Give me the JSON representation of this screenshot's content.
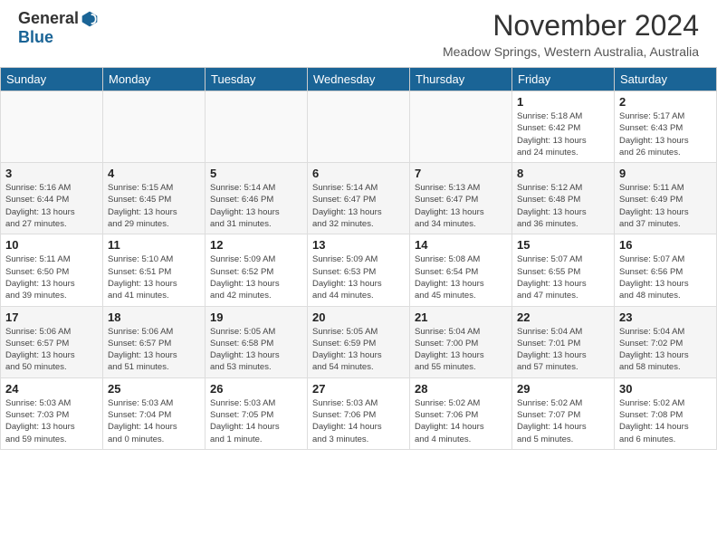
{
  "app": {
    "logo_general": "General",
    "logo_blue": "Blue"
  },
  "header": {
    "title": "November 2024",
    "location": "Meadow Springs, Western Australia, Australia"
  },
  "calendar": {
    "days_of_week": [
      "Sunday",
      "Monday",
      "Tuesday",
      "Wednesday",
      "Thursday",
      "Friday",
      "Saturday"
    ],
    "weeks": [
      {
        "alt": false,
        "days": [
          {
            "num": "",
            "info": "",
            "empty": true
          },
          {
            "num": "",
            "info": "",
            "empty": true
          },
          {
            "num": "",
            "info": "",
            "empty": true
          },
          {
            "num": "",
            "info": "",
            "empty": true
          },
          {
            "num": "",
            "info": "",
            "empty": true
          },
          {
            "num": "1",
            "info": "Sunrise: 5:18 AM\nSunset: 6:42 PM\nDaylight: 13 hours\nand 24 minutes.",
            "empty": false
          },
          {
            "num": "2",
            "info": "Sunrise: 5:17 AM\nSunset: 6:43 PM\nDaylight: 13 hours\nand 26 minutes.",
            "empty": false
          }
        ]
      },
      {
        "alt": true,
        "days": [
          {
            "num": "3",
            "info": "Sunrise: 5:16 AM\nSunset: 6:44 PM\nDaylight: 13 hours\nand 27 minutes.",
            "empty": false
          },
          {
            "num": "4",
            "info": "Sunrise: 5:15 AM\nSunset: 6:45 PM\nDaylight: 13 hours\nand 29 minutes.",
            "empty": false
          },
          {
            "num": "5",
            "info": "Sunrise: 5:14 AM\nSunset: 6:46 PM\nDaylight: 13 hours\nand 31 minutes.",
            "empty": false
          },
          {
            "num": "6",
            "info": "Sunrise: 5:14 AM\nSunset: 6:47 PM\nDaylight: 13 hours\nand 32 minutes.",
            "empty": false
          },
          {
            "num": "7",
            "info": "Sunrise: 5:13 AM\nSunset: 6:47 PM\nDaylight: 13 hours\nand 34 minutes.",
            "empty": false
          },
          {
            "num": "8",
            "info": "Sunrise: 5:12 AM\nSunset: 6:48 PM\nDaylight: 13 hours\nand 36 minutes.",
            "empty": false
          },
          {
            "num": "9",
            "info": "Sunrise: 5:11 AM\nSunset: 6:49 PM\nDaylight: 13 hours\nand 37 minutes.",
            "empty": false
          }
        ]
      },
      {
        "alt": false,
        "days": [
          {
            "num": "10",
            "info": "Sunrise: 5:11 AM\nSunset: 6:50 PM\nDaylight: 13 hours\nand 39 minutes.",
            "empty": false
          },
          {
            "num": "11",
            "info": "Sunrise: 5:10 AM\nSunset: 6:51 PM\nDaylight: 13 hours\nand 41 minutes.",
            "empty": false
          },
          {
            "num": "12",
            "info": "Sunrise: 5:09 AM\nSunset: 6:52 PM\nDaylight: 13 hours\nand 42 minutes.",
            "empty": false
          },
          {
            "num": "13",
            "info": "Sunrise: 5:09 AM\nSunset: 6:53 PM\nDaylight: 13 hours\nand 44 minutes.",
            "empty": false
          },
          {
            "num": "14",
            "info": "Sunrise: 5:08 AM\nSunset: 6:54 PM\nDaylight: 13 hours\nand 45 minutes.",
            "empty": false
          },
          {
            "num": "15",
            "info": "Sunrise: 5:07 AM\nSunset: 6:55 PM\nDaylight: 13 hours\nand 47 minutes.",
            "empty": false
          },
          {
            "num": "16",
            "info": "Sunrise: 5:07 AM\nSunset: 6:56 PM\nDaylight: 13 hours\nand 48 minutes.",
            "empty": false
          }
        ]
      },
      {
        "alt": true,
        "days": [
          {
            "num": "17",
            "info": "Sunrise: 5:06 AM\nSunset: 6:57 PM\nDaylight: 13 hours\nand 50 minutes.",
            "empty": false
          },
          {
            "num": "18",
            "info": "Sunrise: 5:06 AM\nSunset: 6:57 PM\nDaylight: 13 hours\nand 51 minutes.",
            "empty": false
          },
          {
            "num": "19",
            "info": "Sunrise: 5:05 AM\nSunset: 6:58 PM\nDaylight: 13 hours\nand 53 minutes.",
            "empty": false
          },
          {
            "num": "20",
            "info": "Sunrise: 5:05 AM\nSunset: 6:59 PM\nDaylight: 13 hours\nand 54 minutes.",
            "empty": false
          },
          {
            "num": "21",
            "info": "Sunrise: 5:04 AM\nSunset: 7:00 PM\nDaylight: 13 hours\nand 55 minutes.",
            "empty": false
          },
          {
            "num": "22",
            "info": "Sunrise: 5:04 AM\nSunset: 7:01 PM\nDaylight: 13 hours\nand 57 minutes.",
            "empty": false
          },
          {
            "num": "23",
            "info": "Sunrise: 5:04 AM\nSunset: 7:02 PM\nDaylight: 13 hours\nand 58 minutes.",
            "empty": false
          }
        ]
      },
      {
        "alt": false,
        "days": [
          {
            "num": "24",
            "info": "Sunrise: 5:03 AM\nSunset: 7:03 PM\nDaylight: 13 hours\nand 59 minutes.",
            "empty": false
          },
          {
            "num": "25",
            "info": "Sunrise: 5:03 AM\nSunset: 7:04 PM\nDaylight: 14 hours\nand 0 minutes.",
            "empty": false
          },
          {
            "num": "26",
            "info": "Sunrise: 5:03 AM\nSunset: 7:05 PM\nDaylight: 14 hours\nand 1 minute.",
            "empty": false
          },
          {
            "num": "27",
            "info": "Sunrise: 5:03 AM\nSunset: 7:06 PM\nDaylight: 14 hours\nand 3 minutes.",
            "empty": false
          },
          {
            "num": "28",
            "info": "Sunrise: 5:02 AM\nSunset: 7:06 PM\nDaylight: 14 hours\nand 4 minutes.",
            "empty": false
          },
          {
            "num": "29",
            "info": "Sunrise: 5:02 AM\nSunset: 7:07 PM\nDaylight: 14 hours\nand 5 minutes.",
            "empty": false
          },
          {
            "num": "30",
            "info": "Sunrise: 5:02 AM\nSunset: 7:08 PM\nDaylight: 14 hours\nand 6 minutes.",
            "empty": false
          }
        ]
      }
    ]
  }
}
